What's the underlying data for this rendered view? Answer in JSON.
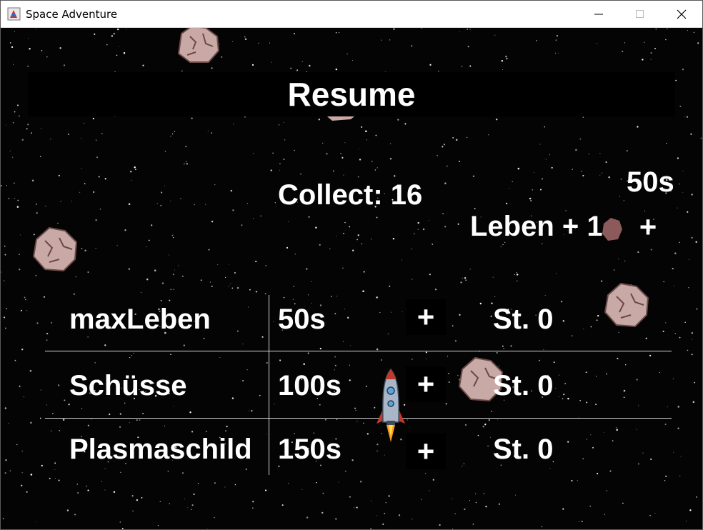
{
  "window": {
    "title": "Space Adventure",
    "icon": "app-icon",
    "controls": [
      "minimize-icon",
      "maximize-icon",
      "close-icon"
    ]
  },
  "menu": {
    "resume_label": "Resume",
    "collect_text": "Collect: 16",
    "life_cost": "50s",
    "life_label": "Leben + 1",
    "life_plus": "+"
  },
  "upgrades": [
    {
      "label": "maxLeben",
      "cost": "50s",
      "plus": "+",
      "count": "St. 0"
    },
    {
      "label": "Schüsse",
      "cost": "100s",
      "plus": "+",
      "count": "St. 0"
    },
    {
      "label": "Plasmaschild",
      "cost": "150s",
      "plus": "+",
      "count": "St. 0"
    }
  ],
  "colors": {
    "background": "#040404",
    "text": "#ffffff",
    "divider": "#d8d8d8",
    "asteroid": "#c9a9a6"
  }
}
